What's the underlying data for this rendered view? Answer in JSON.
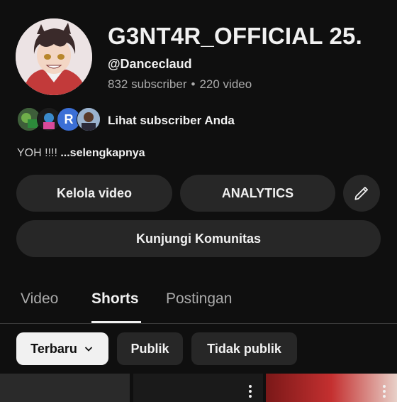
{
  "channel": {
    "name": "G3NT4R_OFFICIAL 25.",
    "handle": "@Danceclaud",
    "subscribers": "832 subscriber",
    "separator": "•",
    "videos": "220 video",
    "avatar_icon": "anime-avatar"
  },
  "subscribers_row": {
    "initial": "R",
    "label": "Lihat subscriber Anda"
  },
  "description": {
    "text": "YOH !!!! ",
    "more": "...selengkapnya"
  },
  "buttons": {
    "manage": "Kelola video",
    "analytics": "ANALYTICS",
    "edit_icon": "pencil-icon",
    "community": "Kunjungi Komunitas"
  },
  "tabs": [
    {
      "label": "Video",
      "active": false
    },
    {
      "label": "Shorts",
      "active": true
    },
    {
      "label": "Postingan",
      "active": false
    }
  ],
  "chips": [
    {
      "label": "Terbaru",
      "selected": true,
      "icon": "chevron-down-icon"
    },
    {
      "label": "Publik",
      "selected": false
    },
    {
      "label": "Tidak publik",
      "selected": false
    }
  ],
  "colors": {
    "background": "#0f0f0f",
    "surface": "#272727",
    "text": "#f1f1f1",
    "secondary_text": "#aaaaaa"
  }
}
